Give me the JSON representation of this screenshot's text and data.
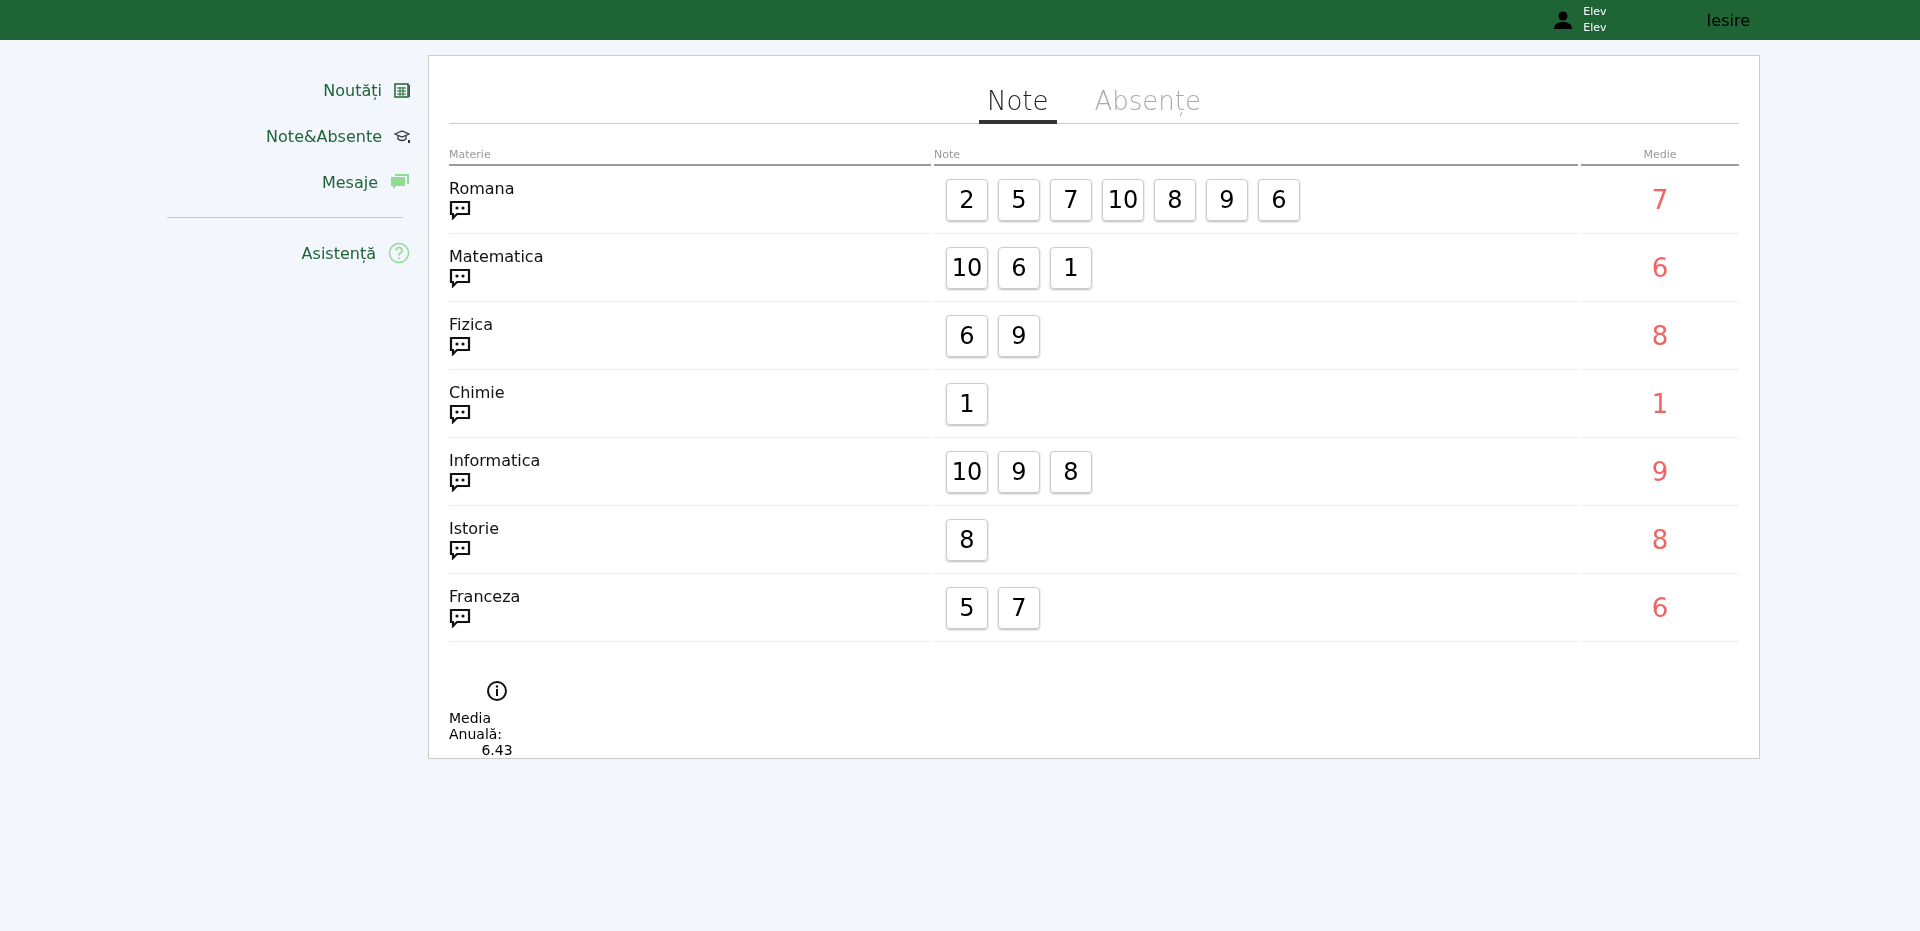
{
  "header": {
    "user_name": "Elev",
    "user_role": "Elev",
    "logout": "Iesire"
  },
  "sidebar": {
    "items": [
      {
        "label": "Noutăți",
        "kind": "news"
      },
      {
        "label": "Note&Absente",
        "kind": "grades"
      },
      {
        "label": "Mesaje",
        "kind": "messages"
      }
    ],
    "help": {
      "label": "Asistență",
      "kind": "help"
    }
  },
  "tabs": [
    {
      "label": "Note",
      "selected": true
    },
    {
      "label": "Absențe",
      "selected": false
    }
  ],
  "table": {
    "columns": [
      "Materie",
      "Note",
      "Medie"
    ],
    "rows": [
      {
        "subject": "Romana",
        "grades": [
          "2",
          "5",
          "7",
          "10",
          "8",
          "9",
          "6"
        ],
        "average": "7"
      },
      {
        "subject": "Matematica",
        "grades": [
          "10",
          "6",
          "1"
        ],
        "average": "6"
      },
      {
        "subject": "Fizica",
        "grades": [
          "6",
          "9"
        ],
        "average": "8"
      },
      {
        "subject": "Chimie",
        "grades": [
          "1"
        ],
        "average": "1"
      },
      {
        "subject": "Informatica",
        "grades": [
          "10",
          "9",
          "8"
        ],
        "average": "9"
      },
      {
        "subject": "Istorie",
        "grades": [
          "8"
        ],
        "average": "8"
      },
      {
        "subject": "Franceza",
        "grades": [
          "5",
          "7"
        ],
        "average": "6"
      }
    ]
  },
  "annual": {
    "label": "Media Anuală:",
    "value": "6.43"
  }
}
